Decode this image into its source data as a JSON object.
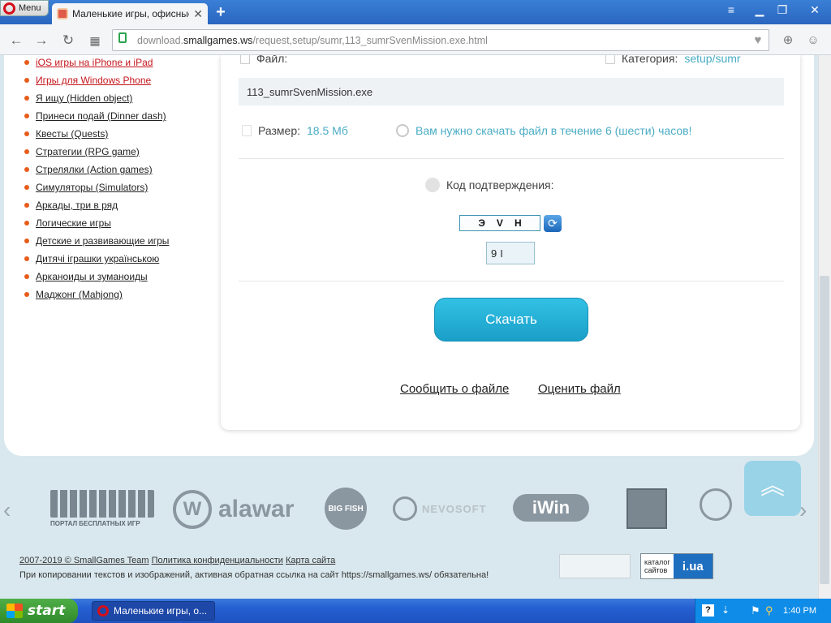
{
  "browser": {
    "menu_label": "Menu",
    "tab_title": "Маленькие игры, офисные",
    "url_prefix": "download.",
    "url_host": "smallgames.ws",
    "url_path": "/request,setup/sumr,113_sumrSvenMission.exe.html"
  },
  "sidebar": {
    "items": [
      {
        "label": "iOS игры на iPhone и iPad"
      },
      {
        "label": "Игры для Windows Phone"
      },
      {
        "label": "Я ищу (Hidden object)"
      },
      {
        "label": "Принеси подай (Dinner dash)"
      },
      {
        "label": "Квесты (Quests)"
      },
      {
        "label": "Стратегии (RPG game)"
      },
      {
        "label": "Стрелялки (Action games)"
      },
      {
        "label": "Симуляторы (Simulators)"
      },
      {
        "label": "Аркады, три в ряд"
      },
      {
        "label": "Логические игры"
      },
      {
        "label": "Детские и развивающие игры"
      },
      {
        "label": "Дитячі іграшки українською"
      },
      {
        "label": "Арканоиды и зуманоиды"
      },
      {
        "label": "Маджонг (Mahjong)"
      }
    ]
  },
  "file": {
    "file_label": "Файл:",
    "category_label": "Категория:",
    "category_value": "setup/sumr",
    "filename": "113_sumrSvenMission.exe",
    "size_label": "Размер:",
    "size_value": "18.5 Мб",
    "deadline_text": "Вам нужно скачать файл в течение 6 (шести) часов!"
  },
  "captcha": {
    "label": "Код подтверждения:",
    "chars": [
      "Э",
      "V",
      "Н"
    ],
    "input_value": "9"
  },
  "actions": {
    "download_label": "Скачать",
    "report_label": "Сообщить о файле",
    "rate_label": "Оценить файл"
  },
  "partners": {
    "myplaycity_caption": "ПОРТАЛ БЕСПЛАТНЫХ ИГР",
    "alawar": "alawar",
    "bigfish": "BIG FISH",
    "nevosoft": "NEVOSOFT",
    "iwin": "iWin"
  },
  "footer": {
    "copyright": "2007-2019 © SmallGames Team",
    "privacy": "Политика конфиденциальности",
    "sitemap": "Карта сайта",
    "notice": "При копировании текстов и изображений, активная обратная ссылка на сайт https://smallgames.ws/ обязательна!",
    "catalog_line1": "каталог",
    "catalog_line2": "сайтов",
    "catalog_brand": "i.ua"
  },
  "taskbar": {
    "start_label": "start",
    "task_label": "Маленькие игры, о...",
    "clock": "1:40 PM"
  }
}
